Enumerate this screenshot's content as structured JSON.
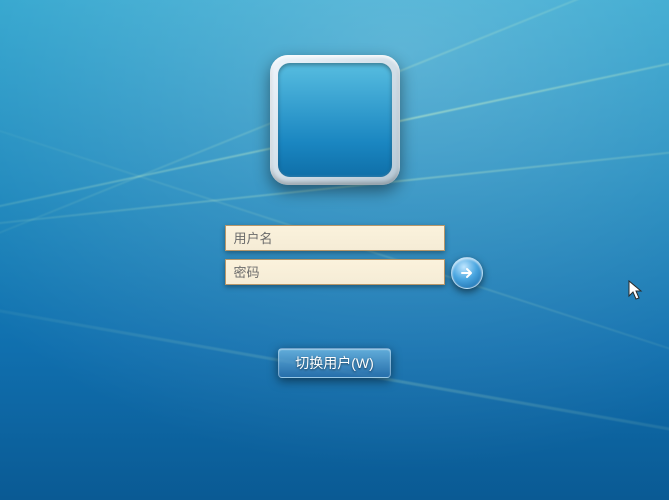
{
  "login": {
    "username_placeholder": "用户名",
    "password_placeholder": "密码",
    "username_value": "",
    "password_value": ""
  },
  "buttons": {
    "switch_user_label": "切换用户(W)"
  },
  "icons": {
    "submit_arrow": "arrow-right-icon",
    "cursor": "mouse-pointer-icon"
  },
  "colors": {
    "bg_top": "#2ca3cd",
    "bg_bottom": "#0a5a94",
    "input_bg": "#f5ecd6",
    "accent": "#1162a3"
  }
}
